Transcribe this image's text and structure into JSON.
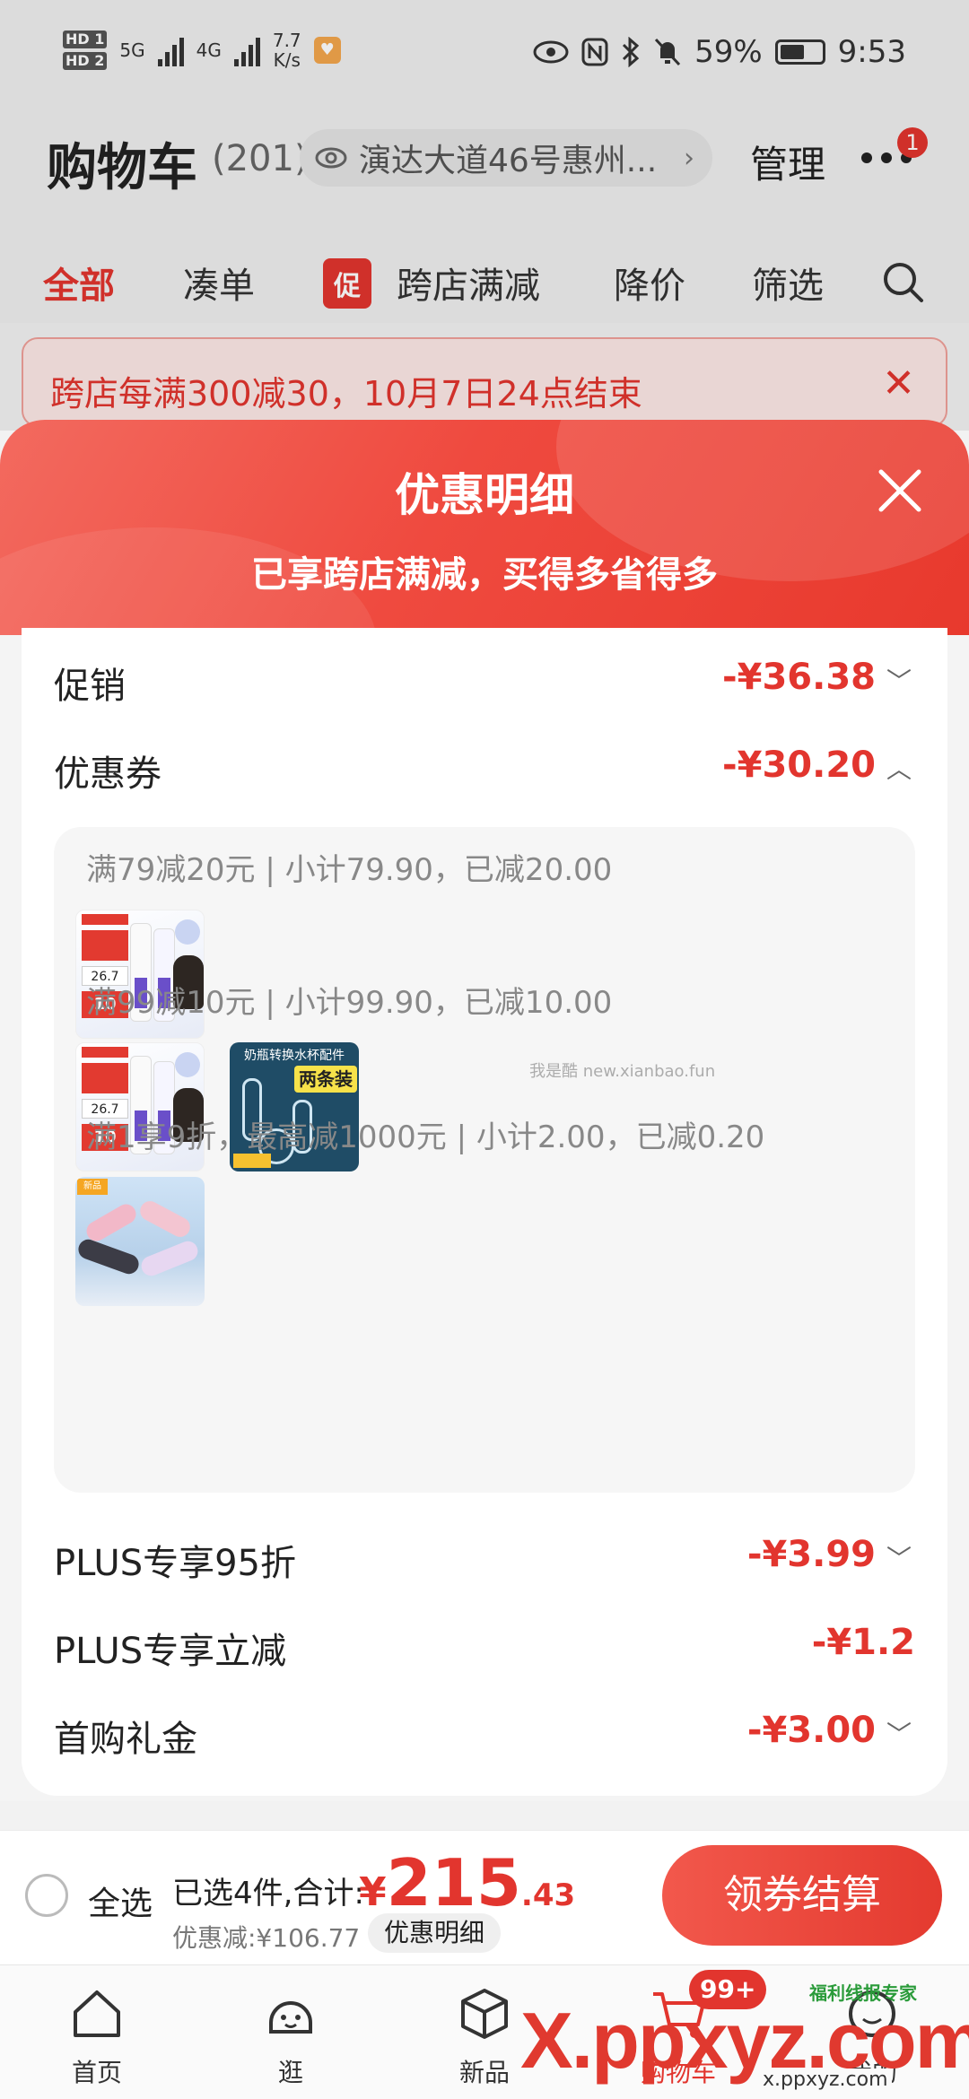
{
  "status_bar": {
    "hd1": "HD 1",
    "hd2": "HD 2",
    "net1": "5G",
    "net2": "4G",
    "speed_value": "7.7",
    "speed_unit": "K/s",
    "battery": "59%",
    "time": "9:53"
  },
  "header": {
    "title": "购物车",
    "count": "(201)",
    "address": "演达大道46号惠州...",
    "manage": "管理",
    "badge": "1"
  },
  "filters": {
    "all": "全部",
    "bundle": "凑单",
    "promo_tag": "促",
    "cross_store": "跨店满减",
    "price_drop": "降价",
    "filter": "筛选"
  },
  "banner": {
    "text": "跨店每满300减30，10月7日24点结束"
  },
  "modal": {
    "title": "优惠明细",
    "subtitle": "已享跨店满减，买得多省得多",
    "rows": {
      "promotion": {
        "label": "促销",
        "amount": "-¥36.38"
      },
      "coupon": {
        "label": "优惠券",
        "amount": "-¥30.20"
      },
      "plus95": {
        "label": "PLUS专享95折",
        "amount": "-¥3.99"
      },
      "plus_instant": {
        "label": "PLUS专享立减",
        "amount": "-¥1.2"
      },
      "first_gift": {
        "label": "首购礼金",
        "amount": "-¥3.00"
      }
    },
    "coupon_groups": [
      {
        "title": "满79减20元 | 小计79.90，已减20.00"
      },
      {
        "title": "满99减10元 | 小计99.90，已减10.00"
      },
      {
        "title": "满1享9折，最高减1000元 | 小计2.00，已减0.20"
      }
    ],
    "thumb_text": {
      "price": "26.7",
      "coupon": "10",
      "bottle_title": "奶瓶转换水杯配件",
      "bottle_tag": "两条装",
      "sleeve_tag": "新品"
    },
    "watermark": "我是酷 new.xianbao.fun"
  },
  "checkout": {
    "select_all": "全选",
    "summary": "已选4件,合计:",
    "currency": "¥",
    "total_int": "215",
    "total_dec": ".43",
    "discount": "优惠减:¥106.77",
    "discount_link": "优惠明细",
    "pay_button": "领券结算"
  },
  "tabbar": {
    "home": "首页",
    "browse": "逛",
    "new": "新品",
    "cart": "购物车",
    "me": "我的",
    "cart_badge": "99+"
  },
  "overlay": {
    "site": "X.ppxyz.com",
    "site_sub": "x.ppxyz.com",
    "badge": "福利线报专家"
  },
  "colors": {
    "accent": "#e2352e",
    "modal_head": "#ef4a3f"
  }
}
